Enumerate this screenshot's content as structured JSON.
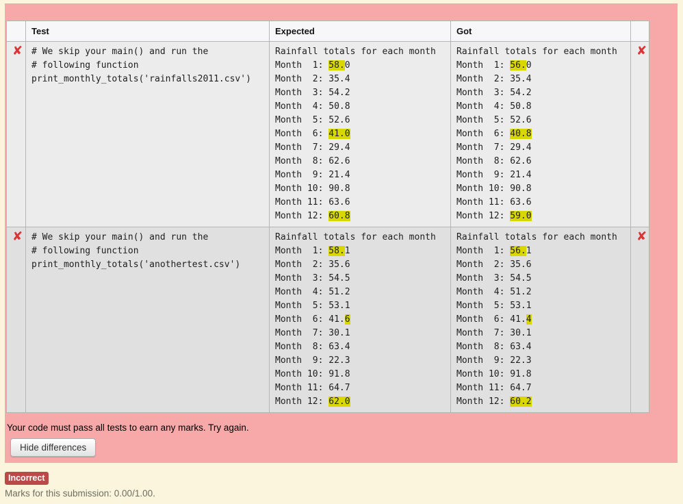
{
  "colors": {
    "page_bg": "#fbf5dd",
    "feedback_bg": "#f7a8a8",
    "diff_highlight": "#d8d800",
    "fail_icon": "#dd3333",
    "badge_bg": "#b94a48",
    "row_even": "#ececec",
    "row_odd": "#e0e0e0"
  },
  "icons": {
    "fail": "✘"
  },
  "table": {
    "headers": [
      "",
      "Test",
      "Expected",
      "Got",
      ""
    ],
    "rows": [
      {
        "passed": false,
        "test_code": [
          "# We skip your main() and run the",
          "# following function",
          "print_monthly_totals('rainfalls2011.csv')"
        ],
        "expected": [
          [
            "Rainfall totals for each month"
          ],
          [
            "Month  1: ",
            {
              "h": "58."
            },
            "0"
          ],
          [
            "Month  2: 35.4"
          ],
          [
            "Month  3: 54.2"
          ],
          [
            "Month  4: 50.8"
          ],
          [
            "Month  5: 52.6"
          ],
          [
            "Month  6: ",
            {
              "h": "41.0"
            }
          ],
          [
            "Month  7: 29.4"
          ],
          [
            "Month  8: 62.6"
          ],
          [
            "Month  9: 21.4"
          ],
          [
            "Month 10: 90.8"
          ],
          [
            "Month 11: 63.6"
          ],
          [
            "Month 12: ",
            {
              "h": "60.8"
            }
          ]
        ],
        "got": [
          [
            "Rainfall totals for each month"
          ],
          [
            "Month  1: ",
            {
              "h": "56."
            },
            "0"
          ],
          [
            "Month  2: 35.4"
          ],
          [
            "Month  3: 54.2"
          ],
          [
            "Month  4: 50.8"
          ],
          [
            "Month  5: 52.6"
          ],
          [
            "Month  6: ",
            {
              "h": "40.8"
            }
          ],
          [
            "Month  7: 29.4"
          ],
          [
            "Month  8: 62.6"
          ],
          [
            "Month  9: 21.4"
          ],
          [
            "Month 10: 90.8"
          ],
          [
            "Month 11: 63.6"
          ],
          [
            "Month 12: ",
            {
              "h": "59.0"
            }
          ]
        ]
      },
      {
        "passed": false,
        "test_code": [
          "# We skip your main() and run the",
          "# following function",
          "print_monthly_totals('anothertest.csv')"
        ],
        "expected": [
          [
            "Rainfall totals for each month"
          ],
          [
            "Month  1: ",
            {
              "h": "58."
            },
            "1"
          ],
          [
            "Month  2: 35.6"
          ],
          [
            "Month  3: 54.5"
          ],
          [
            "Month  4: 51.2"
          ],
          [
            "Month  5: 53.1"
          ],
          [
            "Month  6: 41.",
            {
              "h": "6"
            }
          ],
          [
            "Month  7: 30.1"
          ],
          [
            "Month  8: 63.4"
          ],
          [
            "Month  9: 22.3"
          ],
          [
            "Month 10: 91.8"
          ],
          [
            "Month 11: 64.7"
          ],
          [
            "Month 12: ",
            {
              "h": "62.0"
            }
          ]
        ],
        "got": [
          [
            "Rainfall totals for each month"
          ],
          [
            "Month  1: ",
            {
              "h": "56."
            },
            "1"
          ],
          [
            "Month  2: 35.6"
          ],
          [
            "Month  3: 54.5"
          ],
          [
            "Month  4: 51.2"
          ],
          [
            "Month  5: 53.1"
          ],
          [
            "Month  6: 41.",
            {
              "h": "4"
            }
          ],
          [
            "Month  7: 30.1"
          ],
          [
            "Month  8: 63.4"
          ],
          [
            "Month  9: 22.3"
          ],
          [
            "Month 10: 91.8"
          ],
          [
            "Month 11: 64.7"
          ],
          [
            "Month 12: ",
            {
              "h": "60.2"
            }
          ]
        ]
      }
    ]
  },
  "message": "Your code must pass all tests to earn any marks. Try again.",
  "hide_differences_label": "Hide differences",
  "status_badge": "Incorrect",
  "marks_text": "Marks for this submission: 0.00/1.00."
}
